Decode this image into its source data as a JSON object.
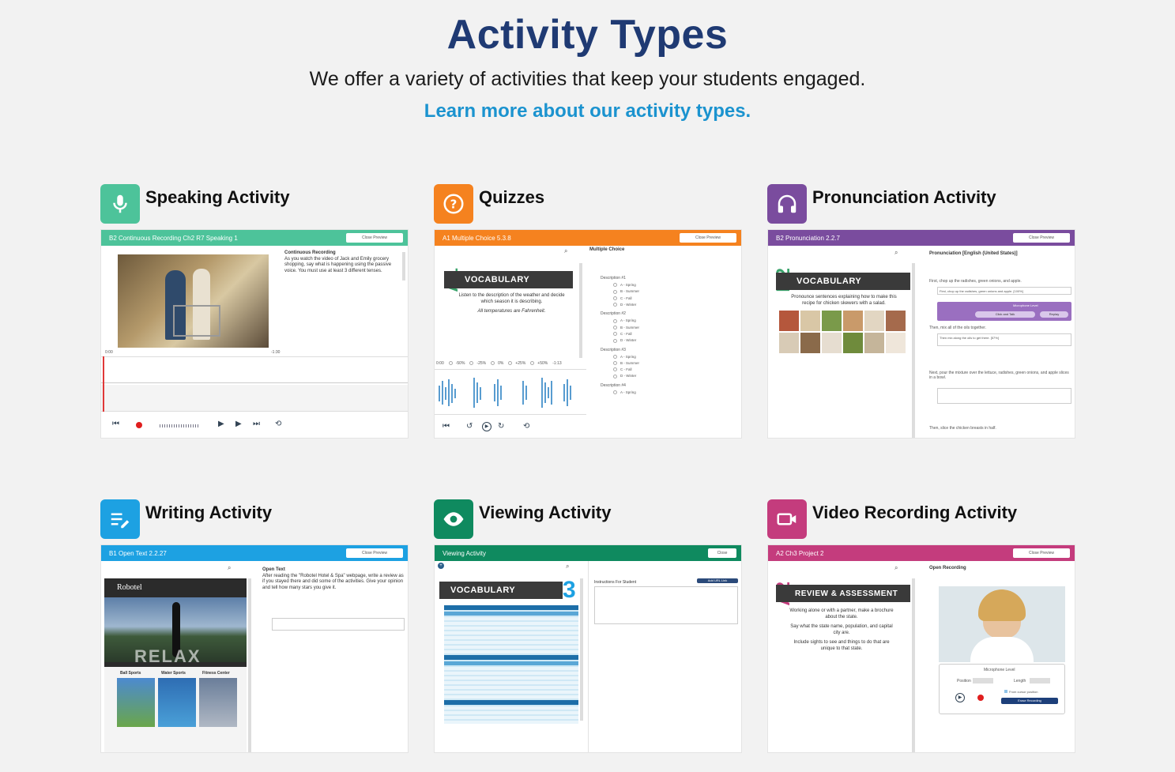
{
  "header": {
    "title": "Activity Types",
    "subtitle": "We offer a variety of activities that keep your students engaged.",
    "link": "Learn more about our activity types."
  },
  "colors": {
    "title": "#1f3a73",
    "link": "#1b93cf",
    "speaking": "#4dc39a",
    "quizzes": "#f5821f",
    "pronunciation": "#7a4c9e",
    "writing": "#1da1e2",
    "viewing": "#0f8a5f",
    "video": "#c43c7d"
  },
  "cards": {
    "speaking": {
      "title": "Speaking Activity",
      "icon": "microphone-icon",
      "bar": "B2 Continuous Recording Ch2 R7 Speaking 1",
      "close": "Close Preview",
      "heading": "Continuous Recording",
      "body": "As you watch the video of Jack and Emily grocery shopping, say what is happening using the passive voice. You must use at least 3 different tenses.",
      "time_start": "0:00",
      "time_end": "-1:30"
    },
    "quizzes": {
      "title": "Quizzes",
      "icon": "question-icon",
      "bar": "A1 Multiple Choice 5.3.8",
      "close": "Close Preview",
      "level": "A1",
      "vocab": "VOCABULARY",
      "instruction": "Listen to the description of the weather and decide which season it is describing.",
      "note": "All temperatures are Fahrenheit.",
      "heading": "Multiple Choice",
      "speeds": [
        "-50%",
        "-25%",
        "0%",
        "+25%",
        "+50%"
      ],
      "time_start": "0:00",
      "time_end": "-1:13",
      "descriptions": [
        "Description #1",
        "Description #2",
        "Description #3",
        "Description #4"
      ],
      "options": [
        "A - Spring",
        "B - Summer",
        "C - Fall",
        "D - Winter"
      ]
    },
    "pronunciation": {
      "title": "Pronunciation Activity",
      "icon": "headphones-icon",
      "bar": "B2 Pronunciation 2.2.7",
      "close": "Close Preview",
      "level": "B2",
      "vocab": "VOCABULARY",
      "instruction": "Pronounce sentences explaining how to make this recipe for chicken skewers with a salad.",
      "heading": "Pronunciation [English (United States)]",
      "items": [
        "First, chop up the radishes, green onions, and apple.",
        "Then, mix all of the oils together.",
        "Next, pour the mixture over the lettuce, radishes, green onions, and apple slices in a bowl.",
        "Then, slice the chicken breasts in half."
      ],
      "answer1": "First, chop up the radishes, green onions and apple. [100%]",
      "answer2": "Then mix along the oils to get there. [57%]",
      "mic_label": "Microphone Level",
      "click_talk": "Click and Talk",
      "replay": "Replay"
    },
    "writing": {
      "title": "Writing Activity",
      "icon": "pencil-list-icon",
      "bar": "B1 Open Text 2.2.27",
      "close": "Close Preview",
      "heading": "Open Text",
      "body": "After reading the \"Robotel Hotel & Spa\" webpage, write a review as if you stayed there and did some of the activities. Give your opinion and tell how many stars you give it.",
      "brand": "Robotel",
      "relax": "RELAX",
      "sports": [
        "Ball Sports",
        "Water Sports",
        "Fitness Center"
      ]
    },
    "viewing": {
      "title": "Viewing Activity",
      "icon": "eye-icon",
      "bar": "Viewing Activity",
      "close": "Close",
      "vocab": "VOCABULARY",
      "unit": "3",
      "instructions": "Instructions For Student",
      "add_button": "Add URL Link"
    },
    "video": {
      "title": "Video Recording Activity",
      "icon": "video-camera-icon",
      "bar": "A2 Ch3 Project 2",
      "close": "Close Preview",
      "level": "A2",
      "banner": "REVIEW & ASSESSMENT",
      "heading": "Open Recording",
      "body1": "Working alone or with a partner, make a brochure about the state.",
      "body2": "Say what the state name, population, and capital city are.",
      "body3": "Include sights to see and things to do that are unique to that state.",
      "mic_label": "Microphone Level",
      "position": "Position",
      "length": "Length",
      "cursor": "From cursor position",
      "erase": "Erase Recording"
    }
  }
}
